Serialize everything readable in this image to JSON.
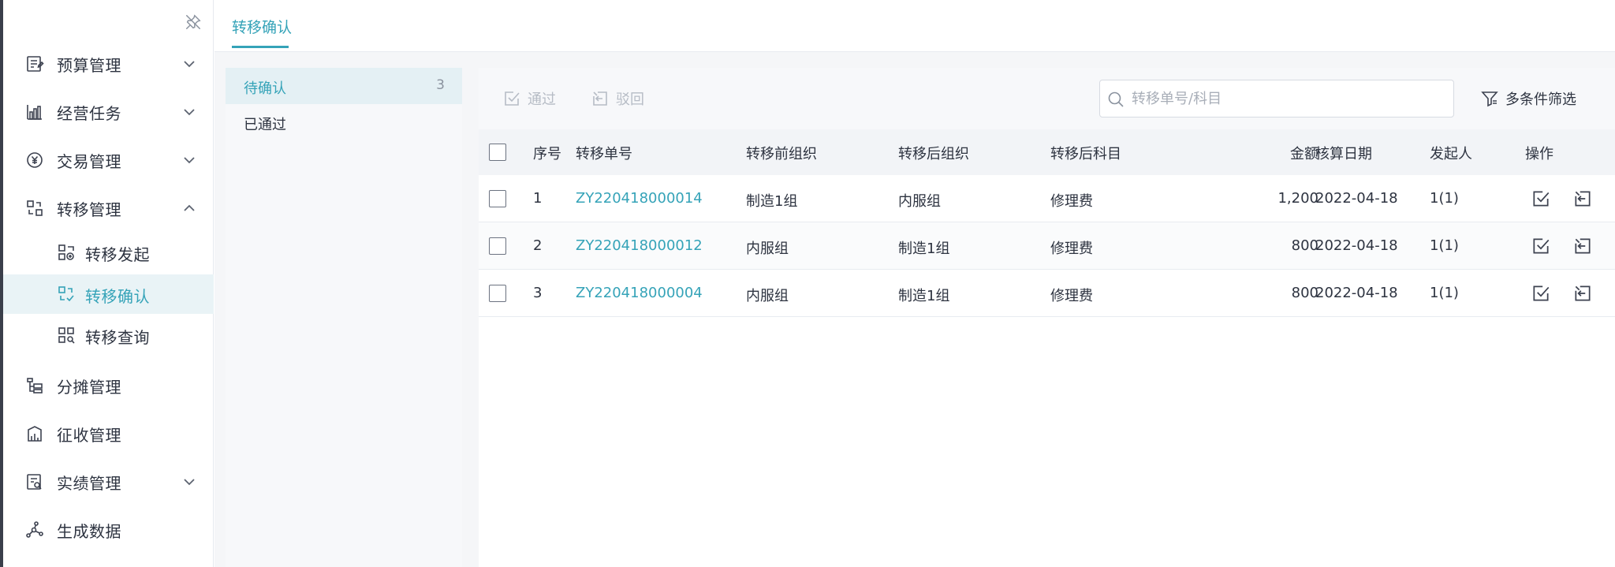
{
  "sidebar": {
    "pin_icon": "pin-off-icon",
    "items": [
      {
        "label": "预算管理",
        "icon": "budget-icon",
        "expanded": false
      },
      {
        "label": "经营任务",
        "icon": "chart-bars-icon",
        "expanded": false
      },
      {
        "label": "交易管理",
        "icon": "yen-coin-icon",
        "expanded": false
      },
      {
        "label": "转移管理",
        "icon": "transfer-icon",
        "expanded": true
      },
      {
        "label": "分摊管理",
        "icon": "allocation-icon"
      },
      {
        "label": "征收管理",
        "icon": "collection-icon"
      },
      {
        "label": "实绩管理",
        "icon": "performance-icon",
        "expanded": false
      },
      {
        "label": "生成数据",
        "icon": "data-nodes-icon"
      }
    ],
    "sub_items": [
      {
        "label": "转移发起",
        "icon": "transfer-initiate-icon"
      },
      {
        "label": "转移确认",
        "icon": "transfer-confirm-icon",
        "active": true
      },
      {
        "label": "转移查询",
        "icon": "transfer-query-icon"
      }
    ]
  },
  "tabs": [
    {
      "label": "转移确认",
      "active": true
    }
  ],
  "status_filters": [
    {
      "label": "待确认",
      "count": "3",
      "active": true
    },
    {
      "label": "已通过",
      "count": ""
    }
  ],
  "toolbar": {
    "approve_label": "通过",
    "reject_label": "驳回",
    "search_placeholder": "转移单号/科目",
    "filter_label": "多条件筛选"
  },
  "table": {
    "headers": {
      "index": "序号",
      "transfer_no": "转移单号",
      "from_org": "转移前组织",
      "to_org": "转移后组织",
      "subject": "转移后科目",
      "amount": "金额",
      "date": "核算日期",
      "initiator": "发起人",
      "action": "操作"
    },
    "rows": [
      {
        "index": "1",
        "transfer_no": "ZY220418000014",
        "from_org": "制造1组",
        "to_org": "内服组",
        "subject": "修理费",
        "amount": "1,200",
        "date": "2022-04-18",
        "initiator": "1(1)"
      },
      {
        "index": "2",
        "transfer_no": "ZY220418000012",
        "from_org": "内服组",
        "to_org": "制造1组",
        "subject": "修理费",
        "amount": "800",
        "date": "2022-04-18",
        "initiator": "1(1)"
      },
      {
        "index": "3",
        "transfer_no": "ZY220418000004",
        "from_org": "内服组",
        "to_org": "制造1组",
        "subject": "修理费",
        "amount": "800",
        "date": "2022-04-18",
        "initiator": "1(1)"
      }
    ]
  },
  "colors": {
    "accent": "#35a3b8",
    "text": "#2d3340",
    "disabled": "#b6bcc5"
  }
}
